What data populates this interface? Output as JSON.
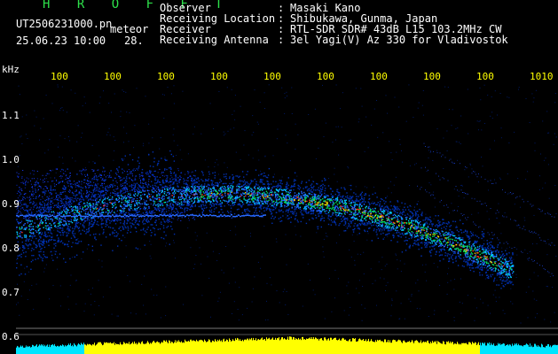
{
  "header": {
    "station": "H R O F F T",
    "file_name": "UT2506231000.pn",
    "tag": "meteor",
    "date_time": "25.06.23 10:00",
    "count": "28.",
    "info": [
      {
        "label": "Observer",
        "value": "Masaki Kano"
      },
      {
        "label": "Receiving Location",
        "value": "Shibukawa, Gunma, Japan"
      },
      {
        "label": "Receiver",
        "value": "RTL-SDR SDR# 43dB L15 103.2MHz CW"
      },
      {
        "label": "Receiving Antenna",
        "value": "3el Yagi(V) Az 330 for Vladivostok"
      }
    ]
  },
  "axes": {
    "y_unit": "kHz",
    "y_ticks": [
      "1.1",
      "1.0",
      "0.9",
      "0.8",
      "0.7",
      "0.6"
    ],
    "x_ticks": [
      "100",
      "100",
      "100",
      "100",
      "100",
      "100",
      "100",
      "100",
      "100",
      "1010"
    ]
  },
  "colors": {
    "background": "#000000",
    "header_title": "#2de04a",
    "tick_labels": "#ffff00",
    "noise_high": "#ffff00",
    "noise_low": "#00e5ff",
    "baseline": "#888888"
  }
}
